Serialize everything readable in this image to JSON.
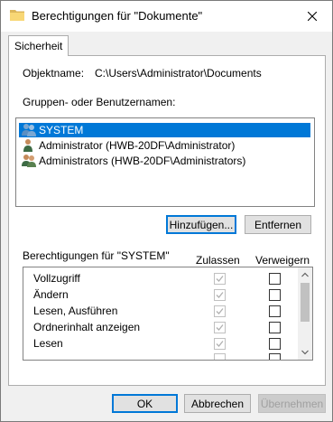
{
  "window": {
    "title": "Berechtigungen für \"Dokumente\"",
    "icon": "folder-icon"
  },
  "tabs": [
    {
      "label": "Sicherheit",
      "active": true
    }
  ],
  "object": {
    "label": "Objektname:",
    "path": "C:\\Users\\Administrator\\Documents"
  },
  "users": {
    "label": "Gruppen- oder Benutzernamen:",
    "items": [
      {
        "name": "SYSTEM",
        "icon": "users-group-icon",
        "selected": true
      },
      {
        "name": "Administrator (HWB-20DF\\Administrator)",
        "icon": "user-icon",
        "selected": false
      },
      {
        "name": "Administrators (HWB-20DF\\Administrators)",
        "icon": "users-group-icon",
        "selected": false
      }
    ],
    "add_button": "Hinzufügen...",
    "remove_button": "Entfernen"
  },
  "permissions": {
    "label": "Berechtigungen für \"SYSTEM\"",
    "allow_header": "Zulassen",
    "deny_header": "Verweigern",
    "rows": [
      {
        "name": "Vollzugriff",
        "allow": true,
        "deny": false
      },
      {
        "name": "Ändern",
        "allow": true,
        "deny": false
      },
      {
        "name": "Lesen, Ausführen",
        "allow": true,
        "deny": false
      },
      {
        "name": "Ordnerinhalt anzeigen",
        "allow": true,
        "deny": false
      },
      {
        "name": "Lesen",
        "allow": true,
        "deny": false
      }
    ]
  },
  "footer": {
    "ok": "OK",
    "cancel": "Abbrechen",
    "apply": "Übernehmen"
  },
  "colors": {
    "selection": "#0078d7",
    "folder": "#f8d775",
    "dialog_bg": "#f0f0f0"
  }
}
